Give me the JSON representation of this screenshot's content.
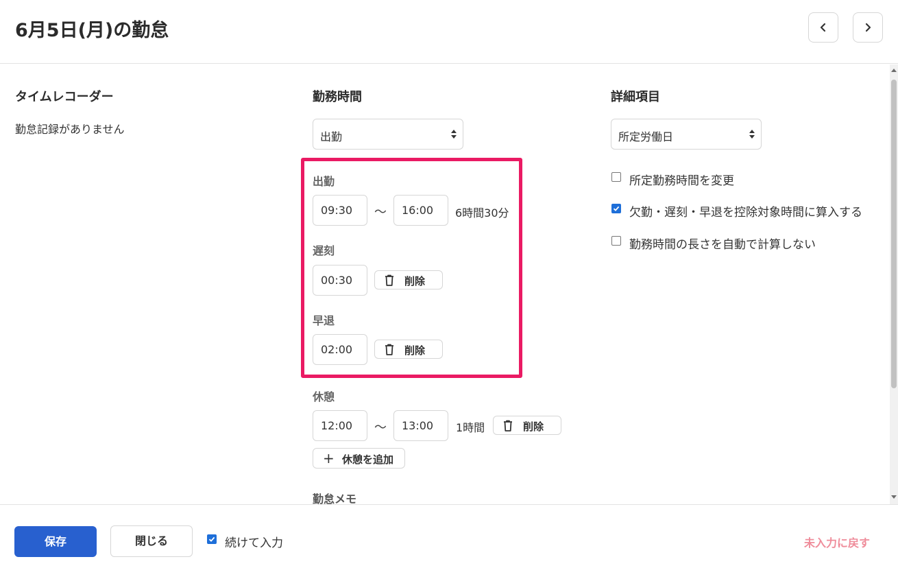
{
  "header": {
    "title": "6月5日(月)の勤怠",
    "prev_icon": "chevron-left-icon",
    "next_icon": "chevron-right-icon"
  },
  "time_recorder": {
    "title": "タイムレコーダー",
    "empty_text": "勤怠記録がありません"
  },
  "work_time": {
    "title": "勤務時間",
    "type_select": "出勤",
    "attendance": {
      "label": "出勤",
      "start": "09:30",
      "tilde": "～",
      "end": "16:00",
      "duration": "6時間30分"
    },
    "late": {
      "label": "遅刻",
      "time": "00:30",
      "delete_label": "削除"
    },
    "early_leave": {
      "label": "早退",
      "time": "02:00",
      "delete_label": "削除"
    },
    "break": {
      "label": "休憩",
      "start": "12:00",
      "tilde": "～",
      "end": "13:00",
      "duration": "1時間",
      "delete_label": "削除"
    },
    "add_break_label": "休憩を追加",
    "memo_label": "勤怠メモ"
  },
  "details": {
    "title": "詳細項目",
    "day_type_select": "所定労働日",
    "options": [
      {
        "label": "所定勤務時間を変更",
        "checked": false
      },
      {
        "label": "欠勤・遅刻・早退を控除対象時間に算入する",
        "checked": true
      },
      {
        "label": "勤務時間の長さを自動で計算しない",
        "checked": false
      }
    ]
  },
  "footer": {
    "save_label": "保存",
    "close_label": "閉じる",
    "continue_label": "続けて入力",
    "continue_checked": true,
    "reset_label": "未入力に戻す"
  },
  "colors": {
    "primary": "#2860cf",
    "highlight": "#ea1a63",
    "reset_text": "#ef8c9a",
    "checkbox": "#1e6fd9"
  }
}
